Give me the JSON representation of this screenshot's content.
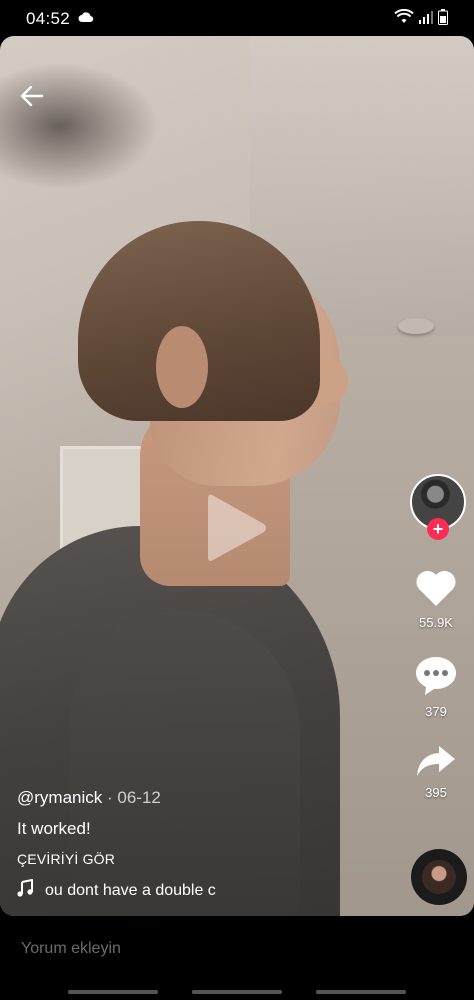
{
  "status": {
    "time": "04:52",
    "left_icon": "cloud-icon",
    "right_icons": [
      "wifi-icon",
      "signal-icon",
      "battery-icon"
    ]
  },
  "video": {
    "play_icon": "play-icon"
  },
  "rail": {
    "likes": "55.9K",
    "comments": "379",
    "shares": "395"
  },
  "caption": {
    "username": "@rymanick",
    "separator": " · ",
    "date": "06-12",
    "description": "It worked!",
    "translate": "ÇEVİRİYİ GÖR",
    "music": "ou dont have a double c"
  },
  "comment_bar": {
    "placeholder": "Yorum ekleyin"
  },
  "colors": {
    "accent": "#fe2c55",
    "background": "#000000"
  }
}
